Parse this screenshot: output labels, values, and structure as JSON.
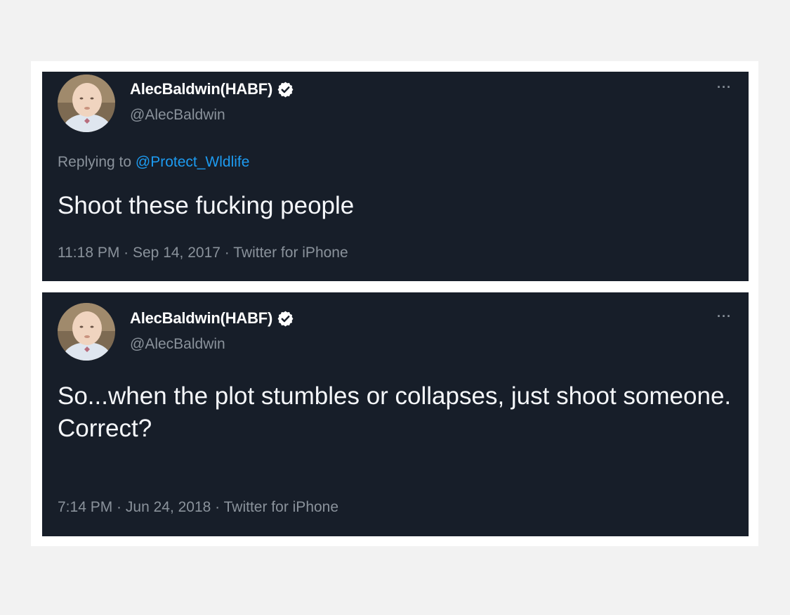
{
  "colors": {
    "page_background": "#f2f2f2",
    "tweet_background": "#171e29",
    "text_primary": "#f5f7fa",
    "text_secondary": "#8a929b",
    "link": "#1d9bf0",
    "verified_badge": "#ffffff"
  },
  "tweets": [
    {
      "author": {
        "display_name": "AlecBaldwin(HABF)",
        "handle": "@AlecBaldwin",
        "verified_icon": "verified-badge-icon",
        "avatar": "baby-photo-avatar"
      },
      "more_icon": "···",
      "reply": {
        "prefix": "Replying to ",
        "mention": "@Protect_Wldlife"
      },
      "text": "Shoot these fucking people",
      "meta": {
        "time": "11:18 PM",
        "sep1": " · ",
        "date": "Sep 14, 2017",
        "sep2": " · ",
        "source": "Twitter for iPhone"
      }
    },
    {
      "author": {
        "display_name": "AlecBaldwin(HABF)",
        "handle": "@AlecBaldwin",
        "verified_icon": "verified-badge-icon",
        "avatar": "baby-photo-avatar"
      },
      "more_icon": "···",
      "text": "So...when the plot stumbles or collapses, just shoot someone.\nCorrect?",
      "meta": {
        "time": "7:14 PM",
        "sep1": " · ",
        "date": "Jun 24, 2018",
        "sep2": " · ",
        "source": "Twitter for iPhone"
      }
    }
  ]
}
